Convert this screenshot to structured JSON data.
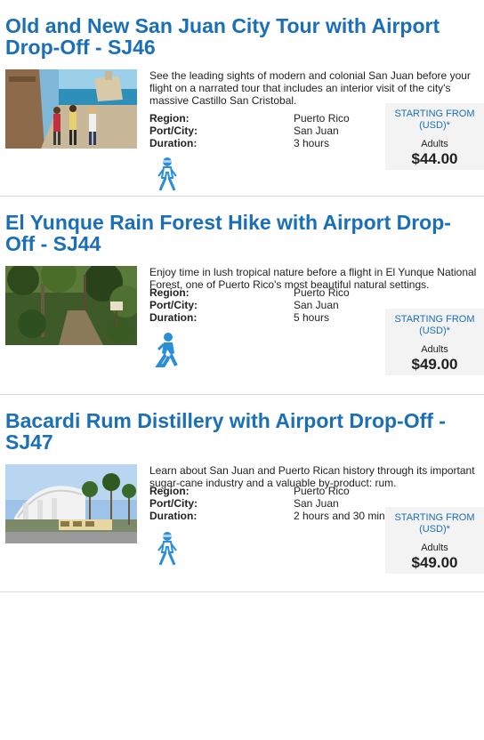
{
  "tours": [
    {
      "title": "Old and New San Juan City Tour with Airport Drop-Off - SJ46",
      "description": "See the leading sights of modern and colonial San Juan before your flight on a narrated tour that includes an interior visit of the city's massive Castillo San Cristobal.",
      "region_label": "Region:",
      "region": "Puerto Rico",
      "port_label": "Port/City:",
      "port": "San Juan",
      "duration_label": "Duration:",
      "duration": "3 hours",
      "starting_from": "STARTING FROM",
      "currency": "(USD)*",
      "adults_label": "Adults",
      "price": "$44.00",
      "activity_icon": "walking-icon"
    },
    {
      "title": "El Yunque Rain Forest Hike with Airport Drop-Off - SJ44",
      "description": "Enjoy time in lush tropical nature before a flight in El Yunque National Forest, one of Puerto Rico's most beautiful natural settings.",
      "region_label": "Region:",
      "region": "Puerto Rico",
      "port_label": "Port/City:",
      "port": "San Juan",
      "duration_label": "Duration:",
      "duration": "5 hours",
      "starting_from": "STARTING FROM",
      "currency": "(USD)*",
      "adults_label": "Adults",
      "price": "$49.00",
      "activity_icon": "hiking-icon"
    },
    {
      "title": "Bacardi Rum Distillery with Airport Drop-Off - SJ47",
      "description": "Learn about San Juan and Puerto Rican history through its important sugar-cane industry and a valuable by-product: rum.",
      "region_label": "Region:",
      "region": "Puerto Rico",
      "port_label": "Port/City:",
      "port": "San Juan",
      "duration_label": "Duration:",
      "duration": "2 hours and 30 min",
      "starting_from": "STARTING FROM",
      "currency": "(USD)*",
      "adults_label": "Adults",
      "price": "$49.00",
      "activity_icon": "walking-icon"
    }
  ],
  "colors": {
    "title": "#1a6fb8",
    "icon": "#2a8ed8",
    "price_box": "#f3f3f3",
    "divider": "#d9d9d9"
  }
}
